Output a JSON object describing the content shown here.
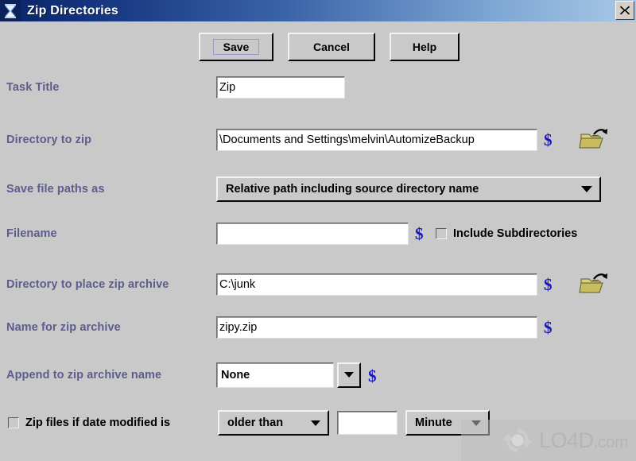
{
  "window": {
    "title": "Zip Directories",
    "icon": "hourglass-icon",
    "close_label": "✕",
    "titlebar_color": "#14337e",
    "face_color": "#c9c9c9"
  },
  "toolbar": {
    "save_label": "Save",
    "cancel_label": "Cancel",
    "help_label": "Help"
  },
  "fields": {
    "task_title": {
      "label": "Task Title",
      "value": "Zip"
    },
    "directory_to_zip": {
      "label": "Directory to zip",
      "value": "\\Documents and Settings\\melvin\\AutomizeBackup",
      "variable_button": "$",
      "browse_button": "open-folder-icon"
    },
    "save_file_paths_as": {
      "label": "Save file paths as",
      "value": "Relative path including source directory name"
    },
    "filename": {
      "label": "Filename",
      "value": "",
      "variable_button": "$"
    },
    "include_subdirectories": {
      "label": "Include Subdirectories",
      "checked": false
    },
    "directory_to_place_zip_archive": {
      "label": "Directory to place zip archive",
      "value": "C:\\junk",
      "variable_button": "$",
      "browse_button": "open-folder-icon"
    },
    "name_for_zip_archive": {
      "label": "Name for zip archive",
      "value": "zipy.zip",
      "variable_button": "$"
    },
    "append_to_zip_archive_name": {
      "label": "Append to zip archive name",
      "value": "None",
      "variable_button": "$"
    },
    "zip_files_if_date_modified": {
      "label": "Zip files if date modified is",
      "checked": false,
      "comparison": "older than",
      "amount": "",
      "unit": "Minute"
    }
  },
  "watermark": {
    "name": "LO4D",
    "suffix": ".com"
  },
  "colors": {
    "label_text": "#5c5c8e",
    "dollar_accent": "#1414c8",
    "folder_icon": "#d8d07a"
  }
}
